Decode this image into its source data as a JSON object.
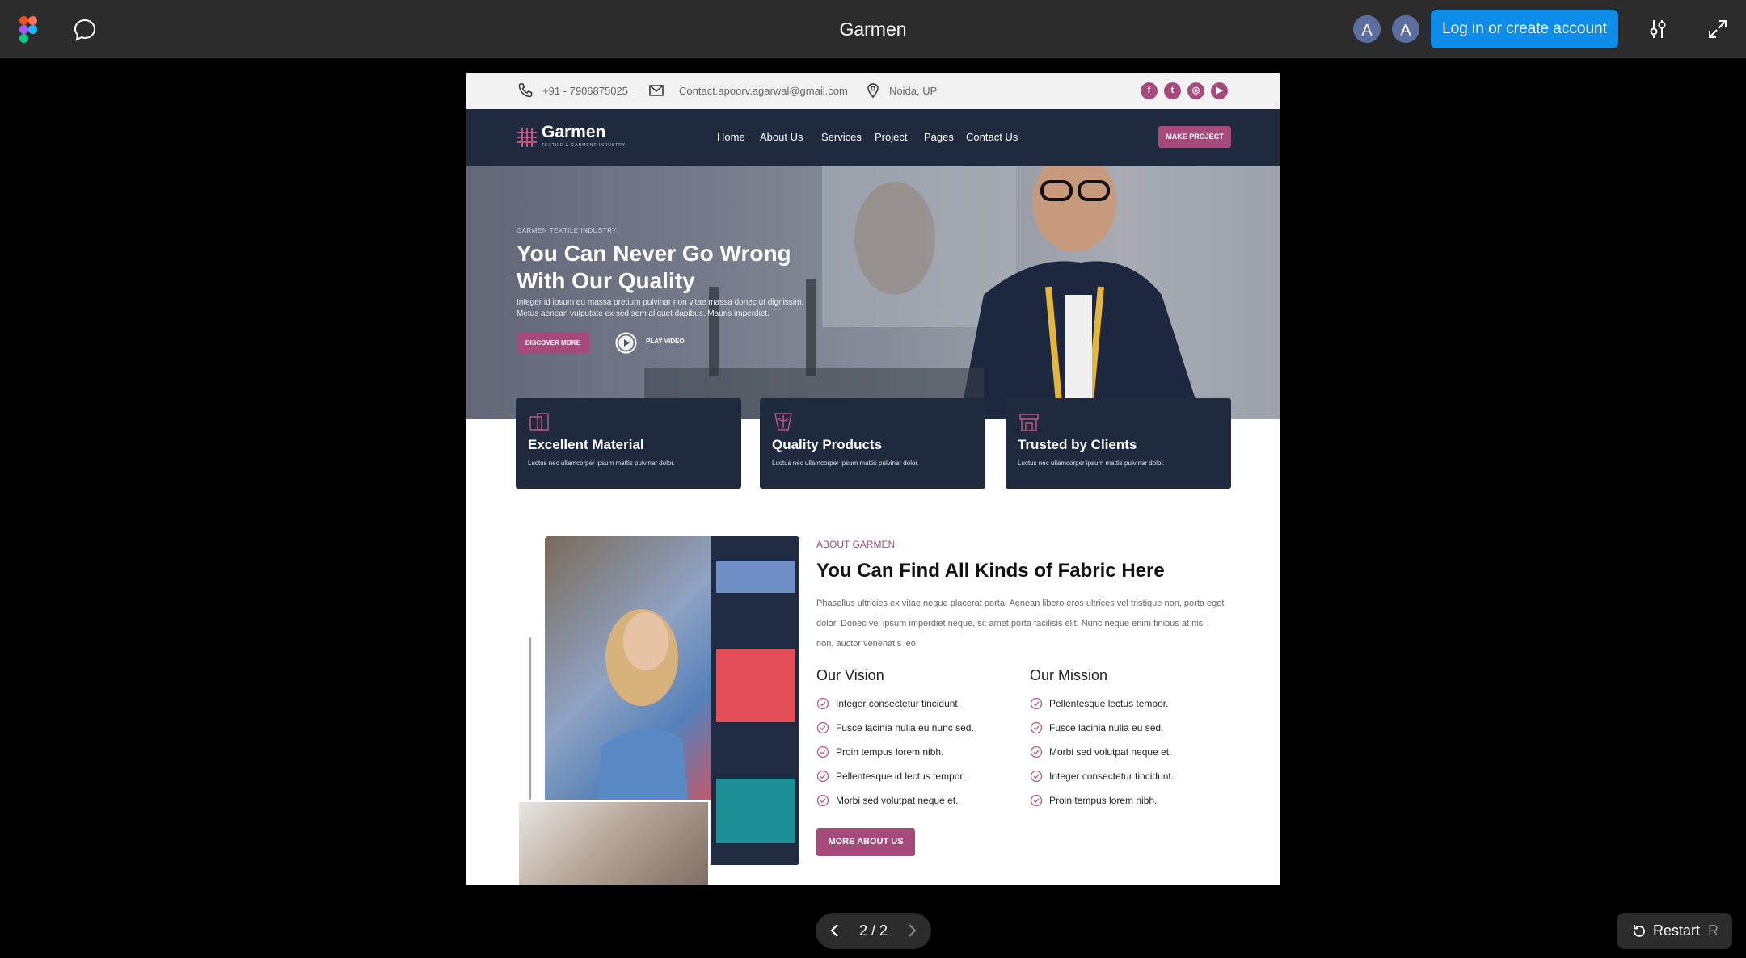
{
  "app": {
    "title": "Garmen",
    "login_label": "Log in or create account",
    "avatars": [
      "A",
      "A"
    ],
    "pager": "2 / 2",
    "restart_label": "Restart",
    "restart_key": "R",
    "accent": "#0d8ce9"
  },
  "site": {
    "contact": {
      "phone": "+91 - 7906875025",
      "email": "Contact.apoorv.agarwal@gmail.com",
      "location": "Noida, UP"
    },
    "socials": [
      "facebook-icon",
      "twitter-icon",
      "instagram-icon",
      "youtube-icon"
    ],
    "brand": {
      "name": "Garmen",
      "tagline": "TEXTILE & GARMENT INDUSTRY",
      "primary": "#1f2a3f",
      "accent": "#a54a7a"
    },
    "nav": [
      "Home",
      "About Us",
      "Services",
      "Project",
      "Pages",
      "Contact Us"
    ],
    "nav_cta": "MAKE PROJECT",
    "hero": {
      "eyebrow": "GARMEN TEXTILE INDUSTRY",
      "title": "You Can Never Go Wrong With Our Quality",
      "desc": "Integer id ipsum eu massa pretium pulvinar non vitae massa donec ut dignissim. Metus aenean vulputate ex sed sem aliquet dapibus. Mauris imperdiet.",
      "cta": "DISCOVER MORE",
      "video_label": "PLAY VIDEO"
    },
    "features": [
      {
        "title": "Excellent Material",
        "desc": "Luctus nec ullamcorper ipsum mattis pulvinar dolor."
      },
      {
        "title": "Quality Products",
        "desc": "Luctus nec ullamcorper ipsum mattis pulvinar dolor."
      },
      {
        "title": "Trusted by Clients",
        "desc": "Luctus nec ullamcorper ipsum mattis pulvinar dolor."
      }
    ],
    "about": {
      "eyebrow": "ABOUT GARMEN",
      "title": "You Can Find All Kinds of Fabric Here",
      "desc": "Phasellus ultricies ex vitae neque placerat porta. Aenean libero eros ultrices vel tristique non, porta eget dolor. Donec vel ipsum imperdiet neque, sit amet porta facilisis elit. Nunc neque enim finibus at nisi non, auctor venenatis leo.",
      "vision_title": "Our Vision",
      "vision": [
        "Integer consectetur tincidunt.",
        "Fusce lacinia nulla eu nunc sed.",
        "Proin tempus lorem nibh.",
        "Pellentesque id lectus tempor.",
        "Morbi sed volutpat neque et."
      ],
      "mission_title": "Our Mission",
      "mission": [
        "Pellentesque lectus tempor.",
        "Fusce lacinia nulla eu sed.",
        "Morbi sed volutpat neque et.",
        "Integer consectetur tincidunt.",
        "Proin tempus lorem nibh."
      ],
      "cta": "MORE ABOUT US"
    }
  }
}
